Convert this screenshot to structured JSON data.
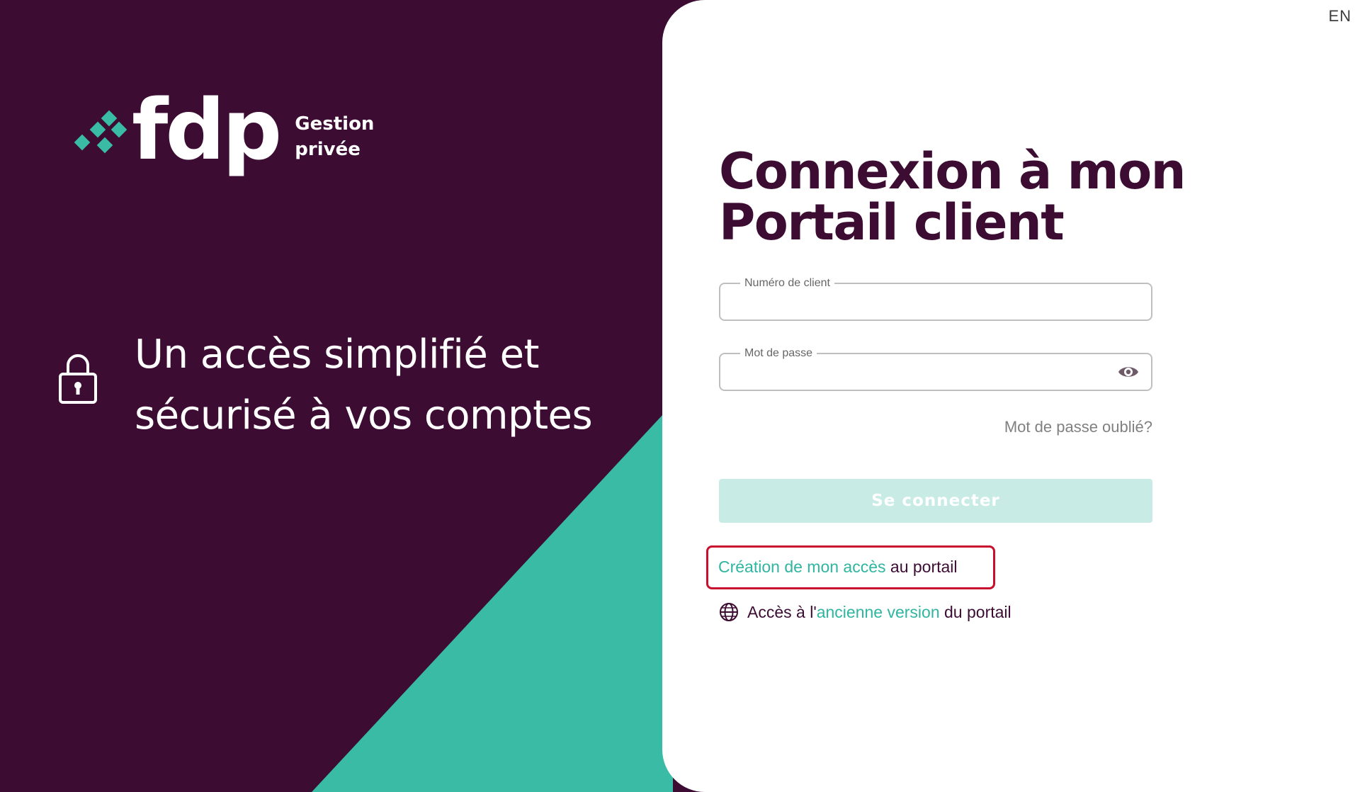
{
  "brand": {
    "wordmark": "fdp",
    "sub_line1": "Gestion",
    "sub_line2": "privée",
    "logo_icon": "diamond-cluster-icon",
    "colors": {
      "dark": "#3c0c33",
      "teal": "#3abba6",
      "teal_light": "#c8ece5",
      "highlight": "#c8102e"
    }
  },
  "tagline": {
    "line1": "Un accès simplifié et",
    "line2": "sécurisé à vos comptes",
    "icon": "lock-icon"
  },
  "language": {
    "label": "EN"
  },
  "login": {
    "title_line1": "Connexion à mon",
    "title_line2": "Portail client",
    "client_field": {
      "label": "Numéro de client",
      "value": ""
    },
    "password_field": {
      "label": "Mot de passe",
      "value": "",
      "toggle_icon": "eye-icon"
    },
    "forgot_label": "Mot de passe oublié?",
    "submit_label": "Se connecter"
  },
  "create_access": {
    "link_text": "Création de mon accès",
    "suffix": "au portail"
  },
  "old_version": {
    "icon": "globe-icon",
    "prefix": "Accès à l'",
    "link_text": "ancienne version",
    "suffix": "du portail"
  }
}
